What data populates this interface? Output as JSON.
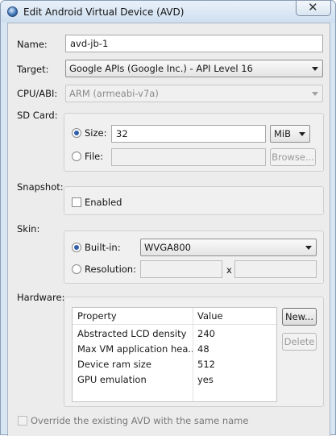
{
  "window": {
    "title": "Edit Android Virtual Device (AVD)",
    "close_glyph": "✕"
  },
  "name": {
    "label": "Name:",
    "value": "avd-jb-1"
  },
  "target": {
    "label": "Target:",
    "value": "Google APIs (Google Inc.) - API Level 16"
  },
  "cpu": {
    "label": "CPU/ABI:",
    "value": "ARM (armeabi-v7a)"
  },
  "sdcard": {
    "label": "SD Card:",
    "size_label": "Size:",
    "size_value": "32",
    "unit": "MiB",
    "file_label": "File:",
    "file_value": "",
    "browse_label": "Browse...",
    "selected": "size"
  },
  "snapshot": {
    "label": "Snapshot:",
    "enabled_label": "Enabled",
    "enabled": false
  },
  "skin": {
    "label": "Skin:",
    "builtin_label": "Built-in:",
    "builtin_value": "WVGA800",
    "resolution_label": "Resolution:",
    "res_w": "",
    "res_sep": "x",
    "res_h": "",
    "selected": "builtin"
  },
  "hardware": {
    "label": "Hardware:",
    "columns": [
      "Property",
      "Value"
    ],
    "rows": [
      {
        "property": "Abstracted LCD density",
        "value": "240"
      },
      {
        "property": "Max VM application hea...",
        "value": "48"
      },
      {
        "property": "Device ram size",
        "value": "512"
      },
      {
        "property": "GPU emulation",
        "value": "yes"
      }
    ],
    "new_label": "New...",
    "delete_label": "Delete"
  },
  "override": {
    "label": "Override the existing AVD with the same name",
    "checked": false
  }
}
